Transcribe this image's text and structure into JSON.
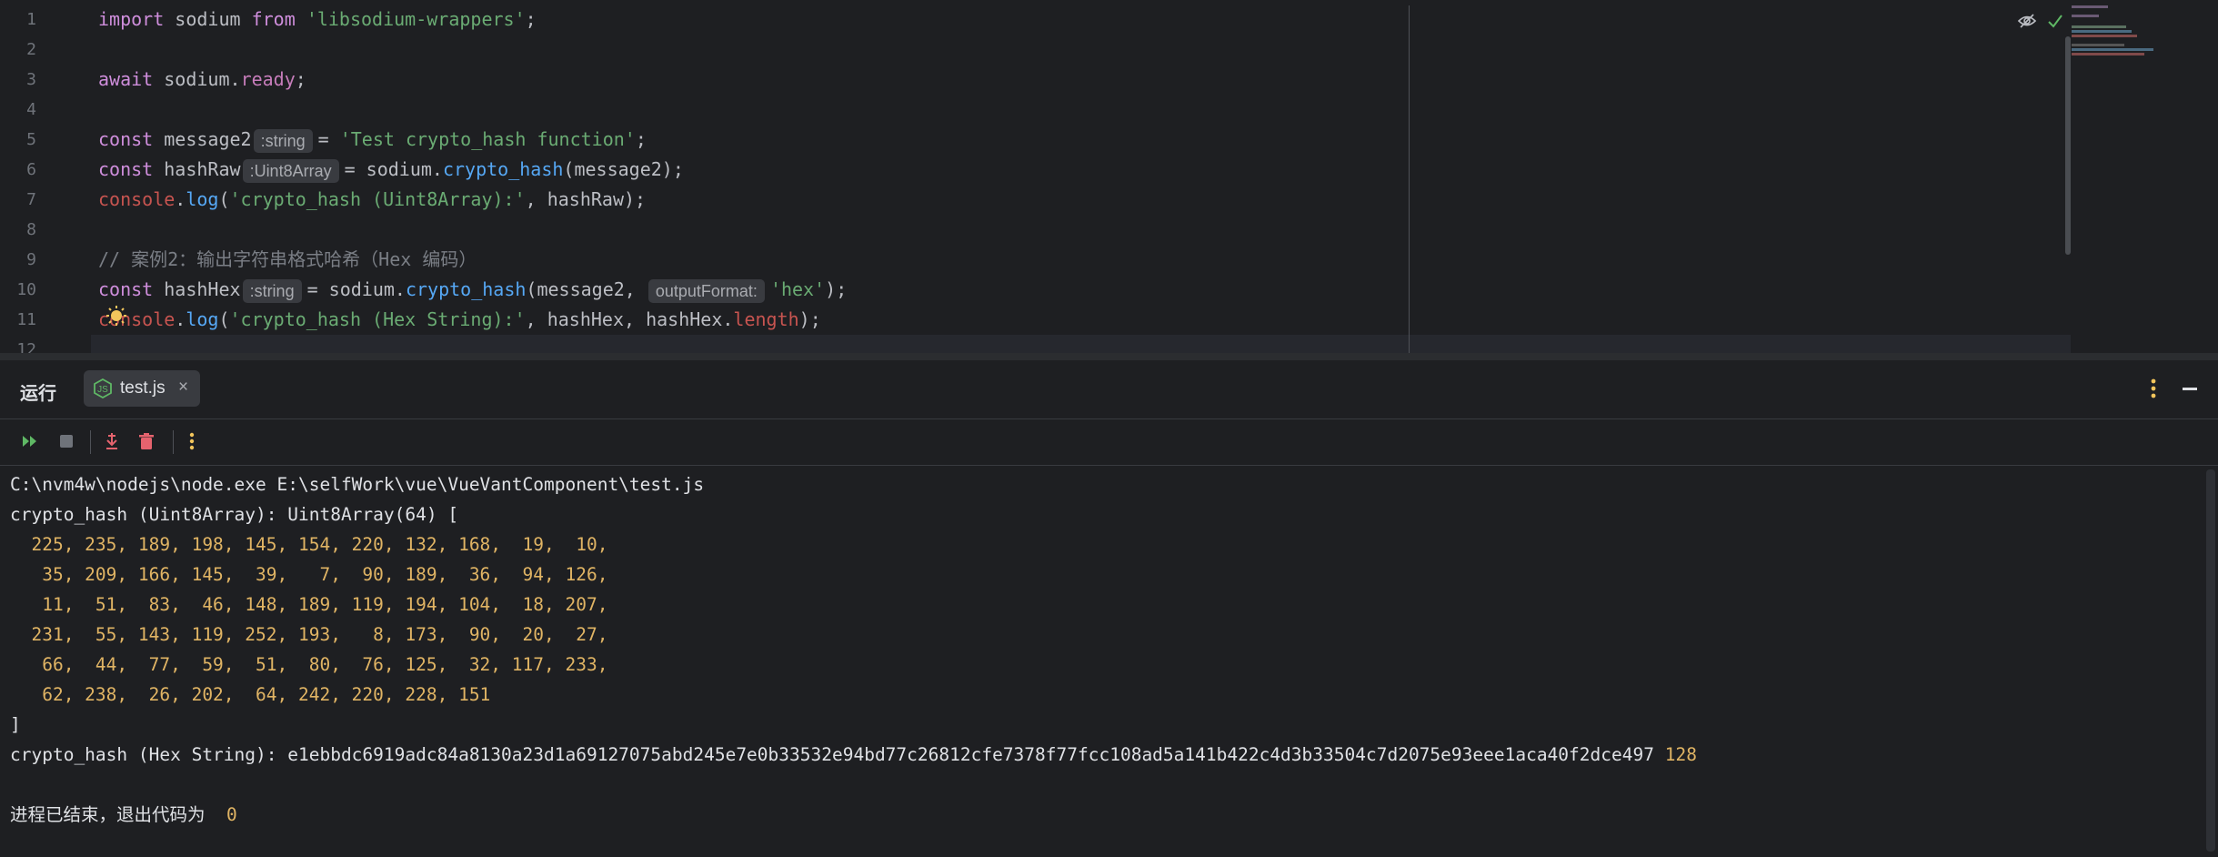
{
  "editor": {
    "lines": [
      {
        "n": "1",
        "parts": [
          [
            "kw",
            "import"
          ],
          [
            "",
            "sodium"
          ],
          [
            "kw",
            "from"
          ],
          [
            "str",
            "'libsodium-wrappers'"
          ],
          [
            "",
            ";"
          ]
        ]
      },
      {
        "n": "2",
        "parts": []
      },
      {
        "n": "3",
        "parts": [
          [
            "kw",
            "await"
          ],
          [
            "",
            "sodium."
          ],
          [
            "prop",
            "ready"
          ],
          [
            "",
            ";"
          ]
        ]
      },
      {
        "n": "4",
        "parts": []
      },
      {
        "n": "5",
        "parts": [
          [
            "kw",
            "const"
          ],
          [
            "",
            "message2"
          ],
          [
            "hint",
            ":string"
          ],
          [
            "",
            "= "
          ],
          [
            "str",
            "'Test crypto_hash function'"
          ],
          [
            "",
            ";"
          ]
        ]
      },
      {
        "n": "6",
        "parts": [
          [
            "kw",
            "const"
          ],
          [
            "",
            "hashRaw"
          ],
          [
            "hint",
            ":Uint8Array"
          ],
          [
            "",
            "= sodium."
          ],
          [
            "fn",
            "crypto_hash"
          ],
          [
            "",
            "(message2);"
          ]
        ]
      },
      {
        "n": "7",
        "parts": [
          [
            "console",
            "console"
          ],
          [
            "",
            "."
          ],
          [
            "fn",
            "log"
          ],
          [
            "",
            "("
          ],
          [
            "str",
            "'crypto_hash (Uint8Array):'"
          ],
          [
            "",
            ", hashRaw);"
          ]
        ]
      },
      {
        "n": "8",
        "parts": []
      },
      {
        "n": "9",
        "parts": [
          [
            "comment",
            "// 案例2：输出字符串格式哈希（Hex 编码）"
          ]
        ]
      },
      {
        "n": "10",
        "parts": [
          [
            "kw",
            "const"
          ],
          [
            "",
            "hashHex"
          ],
          [
            "hint",
            ":string"
          ],
          [
            "",
            "= sodium."
          ],
          [
            "fn",
            "crypto_hash"
          ],
          [
            "",
            "(message2, "
          ],
          [
            "hint",
            "outputFormat:"
          ],
          [
            "str",
            "'hex'"
          ],
          [
            "",
            ");"
          ]
        ]
      },
      {
        "n": "11",
        "parts": [
          [
            "console",
            "console"
          ],
          [
            "",
            "."
          ],
          [
            "fn",
            "log"
          ],
          [
            "",
            "("
          ],
          [
            "str",
            "'crypto_hash (Hex String):'"
          ],
          [
            "",
            ", hashHex, hashHex."
          ],
          [
            "length",
            "length"
          ],
          [
            "",
            ");"
          ]
        ]
      },
      {
        "n": "12",
        "parts": []
      }
    ]
  },
  "run_panel": {
    "title": "运行",
    "tab_label": "test.js",
    "tab_close": "×",
    "output": [
      {
        "cls": "",
        "text": "C:\\nvm4w\\nodejs\\node.exe E:\\selfWork\\vue\\VueVantComponent\\test.js"
      },
      {
        "cls": "",
        "text": "crypto_hash (Uint8Array): Uint8Array(64) ["
      },
      {
        "cls": "num",
        "text": "  225, 235, 189, 198, 145, 154, 220, 132, 168,  19,  10,"
      },
      {
        "cls": "num",
        "text": "   35, 209, 166, 145,  39,   7,  90, 189,  36,  94, 126,"
      },
      {
        "cls": "num",
        "text": "   11,  51,  83,  46, 148, 189, 119, 194, 104,  18, 207,"
      },
      {
        "cls": "num",
        "text": "  231,  55, 143, 119, 252, 193,   8, 173,  90,  20,  27,"
      },
      {
        "cls": "num",
        "text": "   66,  44,  77,  59,  51,  80,  76, 125,  32, 117, 233,"
      },
      {
        "cls": "num",
        "text": "   62, 238,  26, 202,  64, 242, 220, 228, 151"
      },
      {
        "cls": "",
        "text": "]"
      },
      {
        "cls": "",
        "text": "crypto_hash (Hex String): e1ebbdc6919adc84a8130a23d1a69127075abd245e7e0b33532e94bd77c26812cfe7378f77fcc108ad5a141b422c4d3b33504c7d2075e93eee1aca40f2dce497",
        "tail": "128"
      },
      {
        "cls": "",
        "text": ""
      },
      {
        "cls": "",
        "text": "进程已结束，退出代码为 ",
        "tail": "0"
      }
    ]
  },
  "colors": {
    "keyword": "#cf8edc",
    "string": "#6aab73",
    "function": "#56a8f5",
    "console": "#c75450",
    "number": "#e0b464"
  }
}
